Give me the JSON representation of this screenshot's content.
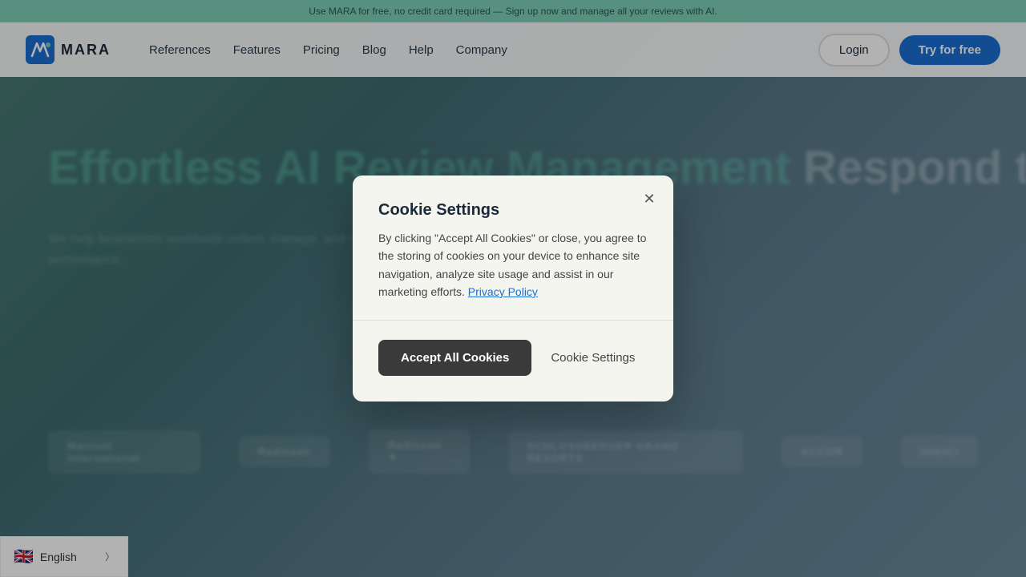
{
  "banner": {
    "text": "Use MARA for free, no credit card required — Sign up now and manage all your reviews with AI.",
    "link_text": "Sign up now and manage all your reviews"
  },
  "navbar": {
    "logo_text": "MARA",
    "links": [
      {
        "label": "References",
        "id": "references"
      },
      {
        "label": "Features",
        "id": "features"
      },
      {
        "label": "Pricing",
        "id": "pricing"
      },
      {
        "label": "Blog",
        "id": "blog"
      },
      {
        "label": "Help",
        "id": "help"
      },
      {
        "label": "Company",
        "id": "company"
      }
    ],
    "login_label": "Login",
    "try_label": "Try for free"
  },
  "hero": {
    "title_part1": "Effortless AI Review Management",
    "title_part2": "Respond to",
    "subtitle": "We help businesses worldwide collect, manage, and respond to their reviews — saving time while boosting performance."
  },
  "partners": [
    {
      "name": "Marriott International"
    },
    {
      "name": "Radisson"
    },
    {
      "name": "Radisson ✦"
    },
    {
      "name": "SCHLOSSBERGER GRAND RESORTS"
    },
    {
      "name": "ACCOR"
    },
    {
      "name": "InterCi"
    }
  ],
  "cookie_modal": {
    "title": "Cookie Settings",
    "body": "By clicking \"Accept All Cookies\" or close, you agree to the storing of cookies on your device to enhance site navigation, analyze site usage and assist in our marketing efforts.",
    "privacy_link": "Privacy Policy",
    "accept_label": "Accept All Cookies",
    "settings_label": "Cookie Settings"
  },
  "language": {
    "label": "English",
    "flag": "🇬🇧"
  }
}
